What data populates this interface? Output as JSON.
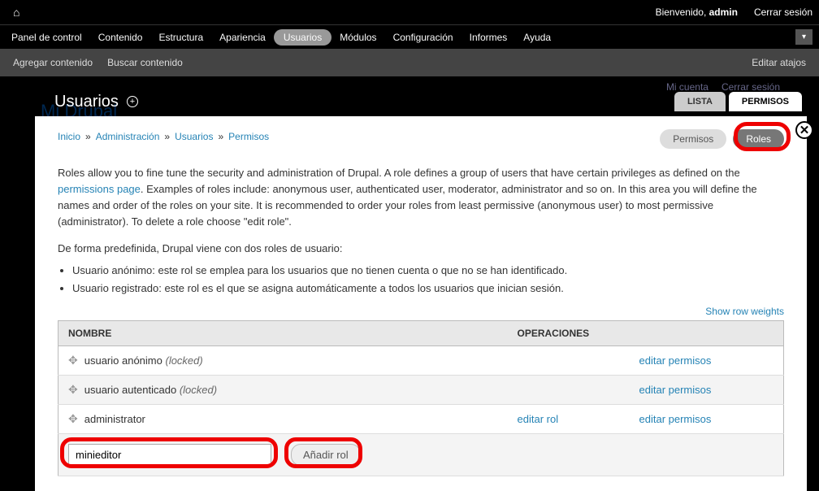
{
  "topbar": {
    "welcome_prefix": "Bienvenido, ",
    "username": "admin",
    "logout": "Cerrar sesión"
  },
  "menu": {
    "items": [
      "Panel de control",
      "Contenido",
      "Estructura",
      "Apariencia",
      "Usuarios",
      "Módulos",
      "Configuración",
      "Informes",
      "Ayuda"
    ],
    "active_index": 4
  },
  "shortcuts": {
    "left": [
      "Agregar contenido",
      "Buscar contenido"
    ],
    "right": "Editar atajos"
  },
  "background": {
    "site_name": "Mi Drupal",
    "account": "Mi cuenta",
    "logout": "Cerrar sesión"
  },
  "overlay": {
    "title": "Usuarios",
    "tabs": [
      {
        "label": "LISTA",
        "active": false
      },
      {
        "label": "PERMISOS",
        "active": true
      }
    ]
  },
  "breadcrumb": {
    "items": [
      "Inicio",
      "Administración",
      "Usuarios",
      "Permisos"
    ]
  },
  "subtabs": [
    {
      "label": "Permisos",
      "active": false
    },
    {
      "label": "Roles",
      "active": true
    }
  ],
  "intro": {
    "text1": "Roles allow you to fine tune the security and administration of Drupal. A role defines a group of users that have certain privileges as defined on the ",
    "link": "permissions page",
    "text2": ". Examples of roles include: anonymous user, authenticated user, moderator, administrator and so on. In this area you will define the names and order of the roles on your site. It is recommended to order your roles from least permissive (anonymous user) to most permissive (administrator). To delete a role choose \"edit role\"."
  },
  "default_roles_text": "De forma predefinida, Drupal viene con dos roles de usuario:",
  "default_roles": [
    "Usuario anónimo: este rol se emplea para los usuarios que no tienen cuenta o que no se han identificado.",
    "Usuario registrado: este rol es el que se asigna automáticamente a todos los usuarios que inician sesión."
  ],
  "show_weights": "Show row weights",
  "table": {
    "headers": [
      "NOMBRE",
      "OPERACIONES"
    ],
    "rows": [
      {
        "name": "usuario anónimo",
        "locked": "(locked)",
        "edit_role": "",
        "edit_perm": "editar permisos"
      },
      {
        "name": "usuario autenticado",
        "locked": "(locked)",
        "edit_role": "",
        "edit_perm": "editar permisos"
      },
      {
        "name": "administrator",
        "locked": "",
        "edit_role": "editar rol",
        "edit_perm": "editar permisos"
      }
    ]
  },
  "add_role": {
    "value": "minieditor",
    "button": "Añadir rol"
  }
}
